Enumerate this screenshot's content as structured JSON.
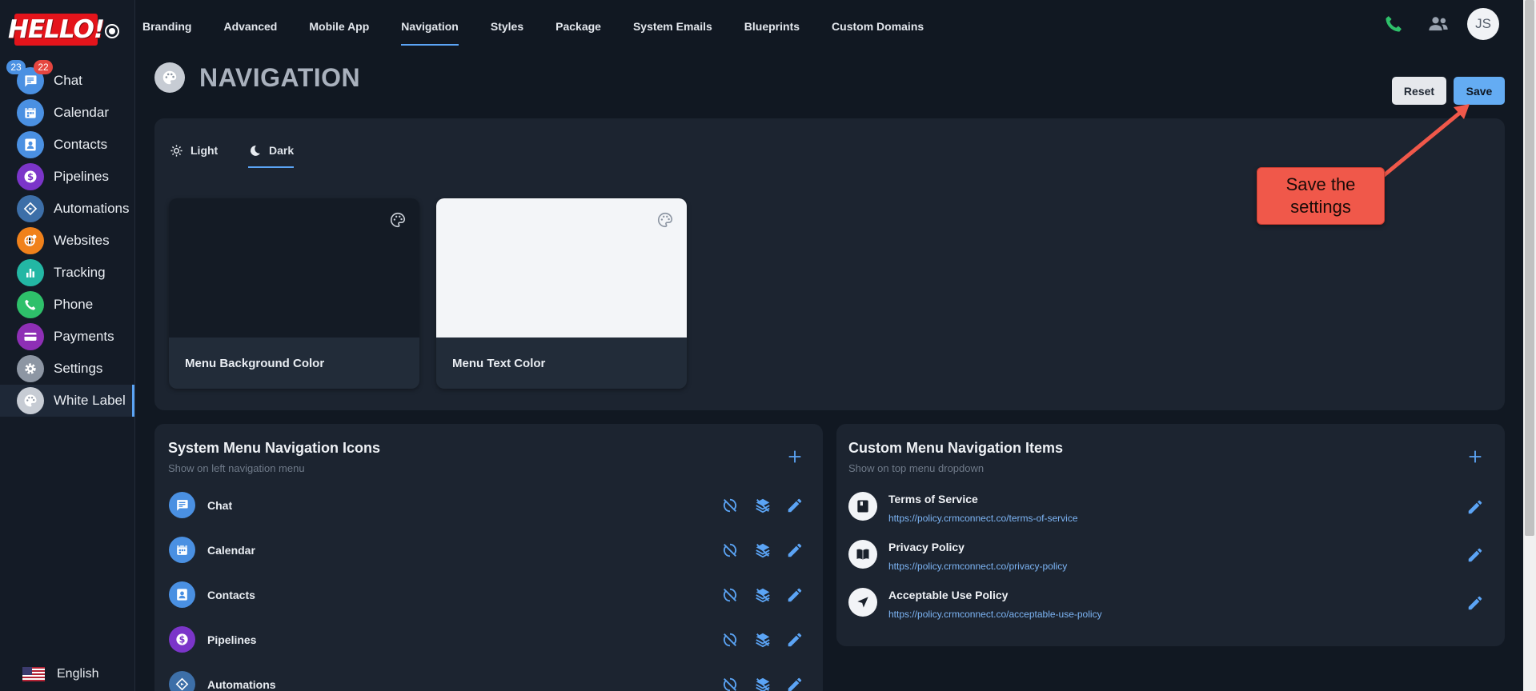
{
  "logo": {
    "text": "HELLO!"
  },
  "sidebar": {
    "badges": {
      "blue": "23",
      "red": "22"
    },
    "items": [
      {
        "label": "Chat",
        "icon": "chat-icon",
        "color": "#4a90e2"
      },
      {
        "label": "Calendar",
        "icon": "calendar-icon",
        "color": "#4a90e2"
      },
      {
        "label": "Contacts",
        "icon": "contacts-icon",
        "color": "#4a90e2"
      },
      {
        "label": "Pipelines",
        "icon": "dollar-icon",
        "color": "#7b35c9"
      },
      {
        "label": "Automations",
        "icon": "automation-icon",
        "color": "#3d6fa8"
      },
      {
        "label": "Websites",
        "icon": "globe-icon",
        "color": "#f0811b"
      },
      {
        "label": "Tracking",
        "icon": "chart-icon",
        "color": "#23b7a4"
      },
      {
        "label": "Phone",
        "icon": "phone-icon",
        "color": "#2ec06a"
      },
      {
        "label": "Payments",
        "icon": "card-icon",
        "color": "#8e2fb5"
      },
      {
        "label": "Settings",
        "icon": "gear-icon",
        "color": "#8d96a3"
      },
      {
        "label": "White Label",
        "icon": "palette-icon",
        "color": "#c7ccd4"
      }
    ],
    "language": "English"
  },
  "topnav": {
    "tabs": [
      "Branding",
      "Advanced",
      "Mobile App",
      "Navigation",
      "Styles",
      "Package",
      "System Emails",
      "Blueprints",
      "Custom Domains"
    ],
    "active": "Navigation",
    "avatar_initials": "JS"
  },
  "page": {
    "title": "NAVIGATION",
    "reset_label": "Reset",
    "save_label": "Save"
  },
  "theme": {
    "modes": [
      "Light",
      "Dark"
    ],
    "active_mode": "Dark",
    "cards": [
      {
        "label": "Menu Background Color",
        "color": "#141b25"
      },
      {
        "label": "Menu Text Color",
        "color": "#f3f5f8"
      }
    ]
  },
  "system_menu": {
    "title": "System Menu Navigation Icons",
    "subtitle": "Show on left navigation menu",
    "items": [
      {
        "label": "Chat",
        "icon": "chat-icon",
        "color": "#4a90e2"
      },
      {
        "label": "Calendar",
        "icon": "calendar-icon",
        "color": "#4a90e2"
      },
      {
        "label": "Contacts",
        "icon": "contacts-icon",
        "color": "#4a90e2"
      },
      {
        "label": "Pipelines",
        "icon": "dollar-icon",
        "color": "#7b35c9"
      },
      {
        "label": "Automations",
        "icon": "automation-icon",
        "color": "#3d6fa8"
      }
    ]
  },
  "custom_menu": {
    "title": "Custom Menu Navigation Items",
    "subtitle": "Show on top menu dropdown",
    "items": [
      {
        "title": "Terms of Service",
        "url": "https://policy.crmconnect.co/terms-of-service",
        "icon": "document-icon"
      },
      {
        "title": "Privacy Policy",
        "url": "https://policy.crmconnect.co/privacy-policy",
        "icon": "book-icon"
      },
      {
        "title": "Acceptable Use Policy",
        "url": "https://policy.crmconnect.co/acceptable-use-policy",
        "icon": "navigation-arrow-icon"
      }
    ]
  },
  "callout": {
    "text": "Save the settings"
  },
  "colors": {
    "accent": "#5ba4f5",
    "callout": "#f0584a",
    "panel": "#1c2430",
    "background": "#111822"
  }
}
